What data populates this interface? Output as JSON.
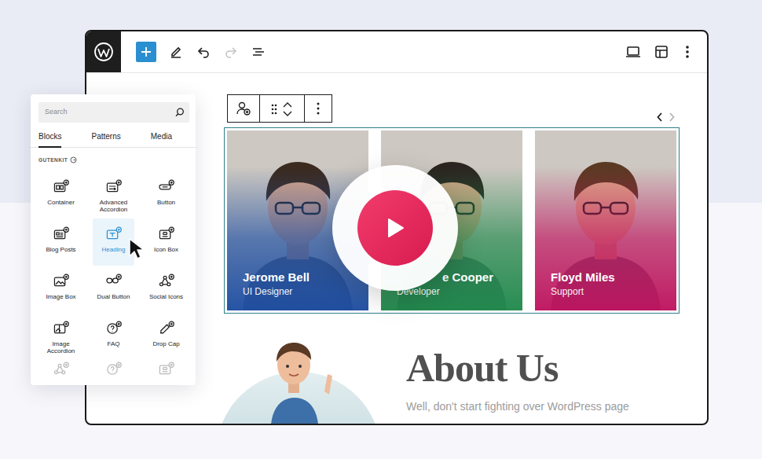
{
  "toolbar": {
    "undo": {
      "disabled": false
    },
    "redo": {
      "disabled": true
    }
  },
  "inserter": {
    "search": {
      "placeholder": "Search"
    },
    "tabs": [
      {
        "label": "Blocks",
        "selected": true
      },
      {
        "label": "Patterns",
        "selected": false
      },
      {
        "label": "Media",
        "selected": false
      }
    ],
    "section": "GUTENKIT",
    "blocks": [
      {
        "label": "Container",
        "selected": false
      },
      {
        "label": "Advanced Accordion",
        "selected": false
      },
      {
        "label": "Button",
        "selected": false
      },
      {
        "label": "Blog Posts",
        "selected": false
      },
      {
        "label": "Heading",
        "selected": true
      },
      {
        "label": "Icon Box",
        "selected": false
      },
      {
        "label": "Image Box",
        "selected": false
      },
      {
        "label": "Dual Button",
        "selected": false
      },
      {
        "label": "Social Icons",
        "selected": false
      },
      {
        "label": "Image Accordion",
        "selected": false
      },
      {
        "label": "FAQ",
        "selected": false
      },
      {
        "label": "Drop Cap",
        "selected": false
      }
    ]
  },
  "carousel": {
    "prev": {
      "disabled": false
    },
    "next": {
      "disabled": true
    },
    "cards": [
      {
        "name": "Jerome Bell",
        "role": "UI Designer",
        "color": "#1d4ea3"
      },
      {
        "name": "e Cooper",
        "role": "Developer",
        "color": "#1f8a4c"
      },
      {
        "name": "Floyd Miles",
        "role": "Support",
        "color": "#c0125f"
      }
    ]
  },
  "about": {
    "heading": "About Us",
    "text": "Well, don't start fighting over WordPress page"
  }
}
